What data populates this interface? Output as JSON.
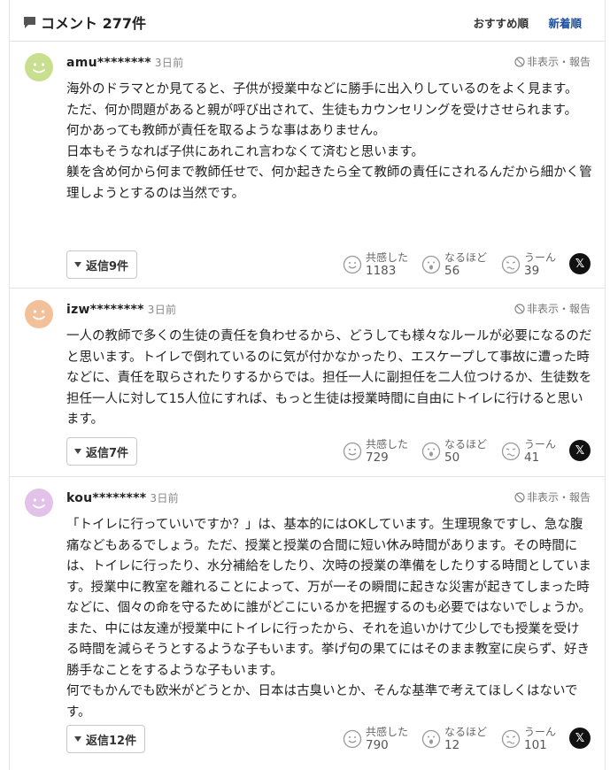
{
  "header": {
    "title": "コメント 277件",
    "sort_recommended": "おすすめ順",
    "sort_newest": "新着順"
  },
  "colors": {
    "accent": "#1a4ea0",
    "avatar_1": "#c8df8f",
    "avatar_2": "#f2c19a",
    "avatar_3": "#e3c2ea"
  },
  "comments": [
    {
      "username": "amu********",
      "time": "3日前",
      "hide_report": "非表示・報告",
      "lines": [
        "海外のドラマとか見てると、子供が授業中などに勝手に出入りしているのをよく見ます。",
        "ただ、何か問題があると親が呼び出されて、生徒もカウンセリングを受けさせられます。",
        "何かあっても教師が責任を取るような事はありません。",
        "日本もそうなれば子供にあれこれ言わなくて済むと思います。",
        "躾を含め何から何まで教師任せで、何か起きたら全て教師の責任にされるんだから細かく管理しようとするのは当然です。"
      ],
      "reply_label": "返信9件",
      "reactions": [
        {
          "label": "共感した",
          "count": "1183"
        },
        {
          "label": "なるほど",
          "count": "56"
        },
        {
          "label": "うーん",
          "count": "39"
        }
      ]
    },
    {
      "username": "izw********",
      "time": "3日前",
      "hide_report": "非表示・報告",
      "lines": [
        "一人の教師で多くの生徒の責任を負わせるから、どうしても様々なルールが必要になるのだと思います。トイレで倒れているのに気が付かなかったり、エスケープして事故に遭った時などに、責任を取らされたりするからでは。担任一人に副担任を二人位つけるか、生徒数を担任一人に対して15人位にすれば、もっと生徒は授業時間に自由にトイレに行けると思います。"
      ],
      "reply_label": "返信7件",
      "reactions": [
        {
          "label": "共感した",
          "count": "729"
        },
        {
          "label": "なるほど",
          "count": "50"
        },
        {
          "label": "うーん",
          "count": "41"
        }
      ]
    },
    {
      "username": "kou********",
      "time": "3日前",
      "hide_report": "非表示・報告",
      "lines": [
        "「トイレに行っていいですか？」は、基本的にはOKしています。生理現象ですし、急な腹痛などもあるでしょう。ただ、授業と授業の合間に短い休み時間があります。その時間には、トイレに行ったり、水分補給をしたり、次時の授業の準備をしたりする時間としています。授業中に教室を離れることによって、万が一その瞬間に起きな災害が起きてしまった時などに、個々の命を守るために誰がどこにいるかを把握するのも必要ではないでしょうか。また、中には友達が授業中にトイレに行ったから、それを追いかけて少しでも授業を受ける時間を減らそうとするような子もいます。挙げ句の果てにはそのまま教室に戻らず、好き勝手なことをするような子もいます。",
        "何でもかんでも欧米がどうとか、日本は古臭いとか、そんな基準で考えてほしくはないです。"
      ],
      "reply_label": "返信12件",
      "reactions": [
        {
          "label": "共感した",
          "count": "790"
        },
        {
          "label": "なるほど",
          "count": "12"
        },
        {
          "label": "うーん",
          "count": "101"
        }
      ]
    }
  ],
  "x_share_glyph": "𝕏"
}
